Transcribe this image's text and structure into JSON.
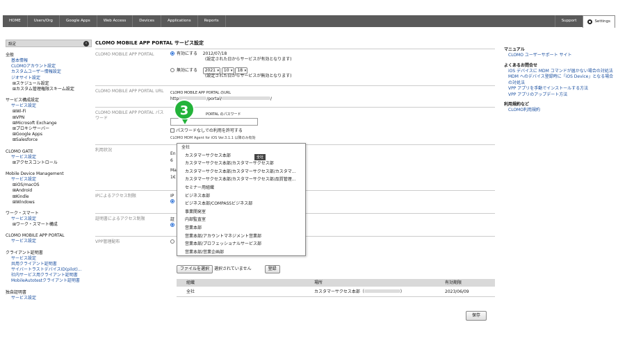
{
  "nav": {
    "items": [
      "HOME",
      "Users/Org",
      "Google Apps",
      "Web Access",
      "Devices",
      "Applications",
      "Reports"
    ],
    "support": "Support",
    "settings": "Settings"
  },
  "sidebar": {
    "head": "設定",
    "collapse_glyph": "‹",
    "sections": [
      {
        "title": "全般",
        "items": [
          {
            "t": "link",
            "label": "基本情報"
          },
          {
            "t": "link",
            "label": "CLOMOアカウント設定"
          },
          {
            "t": "link",
            "label": "カスタムユーザー情報設定"
          },
          {
            "t": "link",
            "label": "ジオサイト設定"
          },
          {
            "t": "tree",
            "label": "⊞スケジュール設定"
          },
          {
            "t": "tree",
            "label": "⊞カスタム管理権限スキーム設定"
          }
        ]
      },
      {
        "title": "サービス構成設定",
        "items": [
          {
            "t": "link",
            "label": "サービス設定"
          },
          {
            "t": "tree",
            "label": "⊞Wi-Fi"
          },
          {
            "t": "tree",
            "label": "⊞VPN"
          },
          {
            "t": "tree",
            "label": "⊞Microsoft Exchange"
          },
          {
            "t": "tree",
            "label": "⊞プロキシサーバー"
          },
          {
            "t": "tree",
            "label": "⊞Google Apps"
          },
          {
            "t": "tree",
            "label": "⊞Salesforce"
          }
        ]
      },
      {
        "title": "CLOMO GATE",
        "items": [
          {
            "t": "link",
            "label": "サービス設定"
          },
          {
            "t": "tree",
            "label": "⊞アクセスコントロール"
          }
        ]
      },
      {
        "title": "Mobile Device Management",
        "items": [
          {
            "t": "link",
            "label": "サービス設定"
          },
          {
            "t": "tree",
            "label": "⊞iOS/macOS"
          },
          {
            "t": "tree",
            "label": "⊞Android"
          },
          {
            "t": "tree",
            "label": "⊞Kindle"
          },
          {
            "t": "tree",
            "label": "⊞Windows"
          }
        ]
      },
      {
        "title": "ワーク・スマート",
        "items": [
          {
            "t": "link",
            "label": "サービス設定"
          },
          {
            "t": "tree",
            "label": "⊞ワーク・スマート構成"
          }
        ]
      },
      {
        "title": "CLOMO MOBILE APP PORTAL",
        "items": [
          {
            "t": "link",
            "label": "サービス設定"
          }
        ]
      },
      {
        "title": "クライアント証明書",
        "items": [
          {
            "t": "link",
            "label": "サービス設定"
          },
          {
            "t": "link",
            "label": "共用クライアント証明書"
          },
          {
            "t": "link",
            "label": "サイバートラストデバイスID(pilot)..."
          },
          {
            "t": "link",
            "label": "社内サービス用クライアント証明書"
          },
          {
            "t": "link",
            "label": "MobileAutotestクライアント証明書"
          }
        ]
      },
      {
        "title": "独自証明書",
        "items": [
          {
            "t": "link",
            "label": "サービス設定"
          }
        ]
      }
    ]
  },
  "main": {
    "title": "CLOMO MOBILE APP PORTAL サービス設定",
    "portal": {
      "label": "CLOMO MOBILE APP PORTAL",
      "enable": "有効にする",
      "enable_date": "2012/07/18",
      "enable_note": "(設定された日からサービスが有効となります)",
      "disable": "無効にする",
      "year": "2021",
      "month": "10",
      "day": "18",
      "disable_note": "(設定された日からサービスが無効となります)"
    },
    "url": {
      "label": "CLOMO MOBILE APP PORTAL URL",
      "caption": "CLOMO MOBILE APP PORTAL のURL",
      "prefix": "http",
      "middle": "/portal/",
      "suffix": "/"
    },
    "password": {
      "label": "CLOMO MOBILE APP PORTAL パスワード",
      "caption": "PORTAL のパスワード",
      "no_password": "パスワードなしでの利用を許可する",
      "note": "CLOMO MDM Agent for iOS Ver.3.1.1 以降のみ有効"
    },
    "usage": {
      "label": "利用状況",
      "line1": "En",
      "line2": "6",
      "line3": "Ma",
      "line4": "1€"
    },
    "ip": {
      "label": "IPによるアクセス制限",
      "line1": "IP"
    },
    "cert": {
      "label": "証明書によるアクセス制限",
      "line1": "証"
    },
    "vpp": {
      "label": "VPP管理配布"
    },
    "file_button": "ファイルを選択",
    "file_status": "選択されていません",
    "register": "登録",
    "save": "保存"
  },
  "popup": {
    "options": [
      "全社",
      "カスタマーサクセス本部",
      "カスタマーサクセス本部/カスタマーサクセス部",
      "カスタマーサクセス本部/カスタマーサクセス部/カスタマ...",
      "カスタマーサクセス本部/カスタマーサクセス部/品質管理...",
      "セミナー用組織",
      "ビジネス本部",
      "ビジネス本部/COMPASSビジネス部",
      "事業開発室",
      "内部監査室",
      "営業本部",
      "営業本部/アカウントマネジメント営業部",
      "営業本部/プロフェッショナルサービス部",
      "営業本部/営業企画部"
    ],
    "tooltip": "全社"
  },
  "badge": "3",
  "table": {
    "headers": [
      "組織",
      "場所",
      "有効期限"
    ],
    "rows": [
      [
        "全社",
        "カスタマーサクセス本部（",
        "2023/06/09"
      ]
    ]
  },
  "right": {
    "groups": [
      {
        "title": "マニュアル",
        "links": [
          "CLOMO ユーザーサポート サイト"
        ]
      },
      {
        "title": "よくあるお問合せ",
        "links": [
          "iOS デバイスに MDM コマンドが届かない場合の対処法",
          "MDM へのデバイス登録時に「iOS Device」となる場合の対処法",
          "VPP アプリを手動でインストールする方法",
          "VPP アプリのアップデート方法"
        ]
      },
      {
        "title": "利用規約など",
        "links": [
          "CLOMO利用規約"
        ]
      }
    ]
  }
}
